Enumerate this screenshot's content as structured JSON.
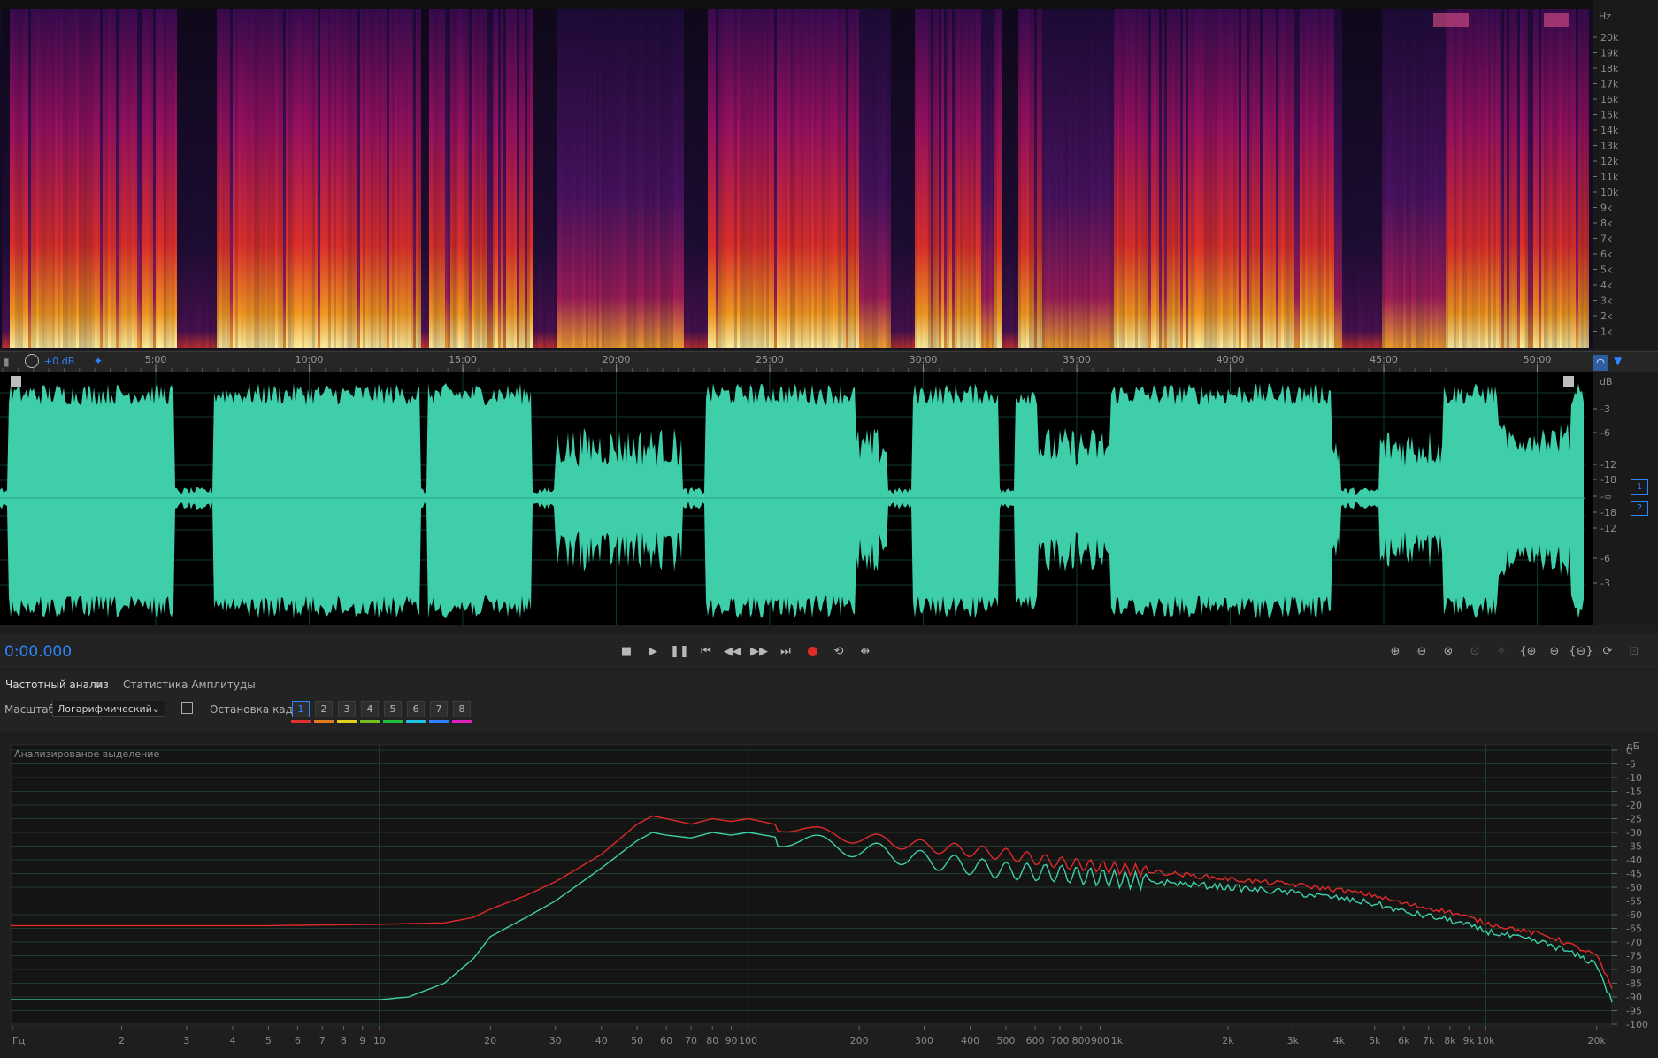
{
  "spectrogram": {
    "hz_unit": "Hz",
    "hz_labels": [
      "20k",
      "19k",
      "18k",
      "17k",
      "16k",
      "15k",
      "14k",
      "13k",
      "12k",
      "11k",
      "10k",
      "9k",
      "8k",
      "7k",
      "6k",
      "5k",
      "4k",
      "3k",
      "2k",
      "1k"
    ]
  },
  "timeline": {
    "gain_label": "+0 dB",
    "ticks": [
      "5:00",
      "10:00",
      "15:00",
      "20:00",
      "25:00",
      "30:00",
      "35:00",
      "40:00",
      "45:00",
      "50:00"
    ]
  },
  "waveform": {
    "db_unit": "dB",
    "db_labels_top": [
      "-3",
      "-6",
      "-12",
      "-18",
      "-∞"
    ],
    "db_labels_bottom": [
      "-18",
      "-12",
      "-6",
      "-3"
    ],
    "channels": [
      "1",
      "2"
    ],
    "colors": {
      "wave": "#3ecfaa",
      "background": "#000000"
    }
  },
  "transport": {
    "time": "0:00.000",
    "buttons": [
      "stop",
      "play",
      "pause",
      "skip-start",
      "rewind",
      "fast-forward",
      "skip-end",
      "record",
      "loop",
      "skip-selection"
    ]
  },
  "panel": {
    "tab_freq": "Частотный анализ",
    "tab_amp": "Статистика Амплитуды",
    "scale_label": "Масштаб:",
    "scale_value": "Логарифмический",
    "freeze_label": "Остановка кадра:",
    "frames": [
      "1",
      "2",
      "3",
      "4",
      "5",
      "6",
      "7",
      "8"
    ],
    "frame_colors": [
      "#e03030",
      "#e07a20",
      "#e0d020",
      "#70c020",
      "#20c040",
      "#20c0e0",
      "#3080ff",
      "#e020c0"
    ]
  },
  "chart_data": {
    "type": "line",
    "title": "Анализированое выделение",
    "xlabel": "Гц",
    "ylabel": "дБ",
    "x_scale": "log",
    "xlim": [
      1,
      22000
    ],
    "ylim": [
      -100,
      0
    ],
    "x_ticks": [
      "Гц",
      "2",
      "3",
      "4",
      "5",
      "6",
      "7",
      "8",
      "9",
      "10",
      "20",
      "30",
      "40",
      "50",
      "60",
      "70",
      "80",
      "90",
      "100",
      "200",
      "300",
      "400",
      "500",
      "600",
      "700",
      "800",
      "900",
      "1k",
      "2k",
      "3k",
      "4k",
      "5k",
      "6k",
      "7k",
      "8k",
      "9k",
      "10k",
      "20k"
    ],
    "y_ticks": [
      "дБ",
      "0",
      "-5",
      "-10",
      "-15",
      "-20",
      "-25",
      "-30",
      "-35",
      "-40",
      "-45",
      "-50",
      "-55",
      "-60",
      "-65",
      "-70",
      "-75",
      "-80",
      "-85",
      "-90",
      "-95",
      "-100"
    ],
    "grid": true,
    "series": [
      {
        "color": "#e02a2a",
        "points": [
          [
            1,
            -64
          ],
          [
            5,
            -64
          ],
          [
            10,
            -63.5
          ],
          [
            15,
            -63
          ],
          [
            18,
            -61
          ],
          [
            20,
            -58
          ],
          [
            25,
            -53
          ],
          [
            30,
            -48
          ],
          [
            40,
            -38
          ],
          [
            50,
            -27
          ],
          [
            55,
            -24
          ],
          [
            60,
            -25
          ],
          [
            70,
            -27
          ],
          [
            80,
            -25
          ],
          [
            90,
            -26
          ],
          [
            100,
            -25
          ],
          [
            150,
            -30
          ],
          [
            200,
            -32
          ],
          [
            300,
            -35
          ],
          [
            500,
            -38
          ],
          [
            700,
            -41
          ],
          [
            1000,
            -43
          ],
          [
            2000,
            -47
          ],
          [
            3000,
            -49
          ],
          [
            4000,
            -51
          ],
          [
            5000,
            -53
          ],
          [
            6000,
            -56
          ],
          [
            8000,
            -59
          ],
          [
            10000,
            -63
          ],
          [
            15000,
            -68
          ],
          [
            20000,
            -75
          ],
          [
            22000,
            -87
          ]
        ]
      },
      {
        "color": "#3ecfaa",
        "points": [
          [
            1,
            -91
          ],
          [
            5,
            -91
          ],
          [
            10,
            -91
          ],
          [
            12,
            -90
          ],
          [
            15,
            -85
          ],
          [
            18,
            -76
          ],
          [
            20,
            -68
          ],
          [
            25,
            -61
          ],
          [
            30,
            -55
          ],
          [
            40,
            -43
          ],
          [
            50,
            -33
          ],
          [
            55,
            -30
          ],
          [
            60,
            -31
          ],
          [
            70,
            -32
          ],
          [
            80,
            -30
          ],
          [
            90,
            -31
          ],
          [
            100,
            -30
          ],
          [
            150,
            -34
          ],
          [
            200,
            -36
          ],
          [
            300,
            -40
          ],
          [
            500,
            -44
          ],
          [
            700,
            -45
          ],
          [
            1000,
            -47
          ],
          [
            2000,
            -50
          ],
          [
            3000,
            -52
          ],
          [
            4000,
            -54
          ],
          [
            5000,
            -56
          ],
          [
            6000,
            -59
          ],
          [
            8000,
            -62
          ],
          [
            10000,
            -66
          ],
          [
            15000,
            -71
          ],
          [
            20000,
            -78
          ],
          [
            22000,
            -92
          ]
        ]
      }
    ]
  }
}
